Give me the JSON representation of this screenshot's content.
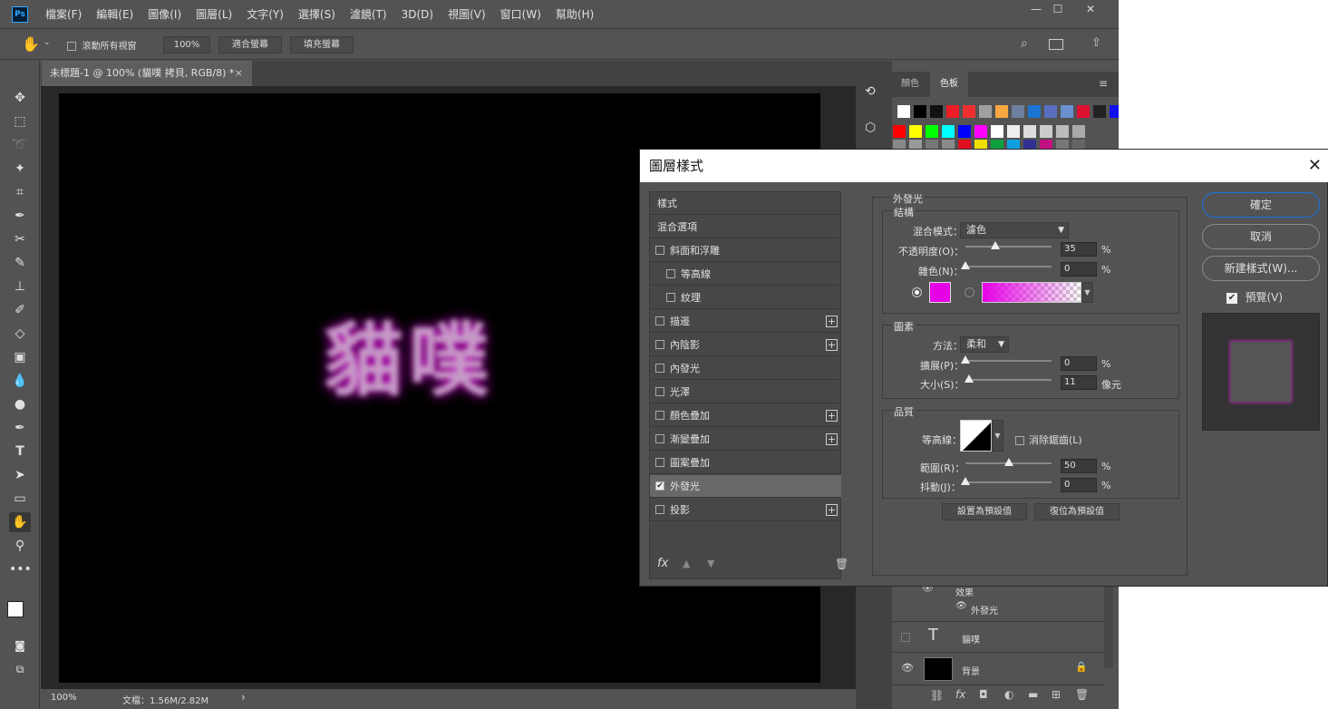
{
  "app": {
    "logo": "Ps"
  },
  "menu": [
    "檔案(F)",
    "編輯(E)",
    "圖像(I)",
    "圖層(L)",
    "文字(Y)",
    "選擇(S)",
    "濾鏡(T)",
    "3D(D)",
    "視圖(V)",
    "窗口(W)",
    "幫助(H)"
  ],
  "window_controls": {
    "minimize": "—",
    "restore": "☐",
    "close": "✕"
  },
  "options": {
    "scroll_all": "滾動所有視窗",
    "zoom": "100%",
    "fit_screen": "適合螢幕",
    "fill_screen": "填充螢幕"
  },
  "document": {
    "tab_title": "未標題-1 @ 100% (貓噗 拷貝, RGB/8) *",
    "tab_close": "×",
    "canvas_text": "貓噗"
  },
  "status": {
    "zoom": "100%",
    "doc_info": "文檔：1.56M/2.82M",
    "arrow": "›"
  },
  "panels": {
    "tab_color": "顏色",
    "tab_swatches": "色板"
  },
  "swatches_row1": [
    "#ffffff",
    "#000000",
    "#111111",
    "#ee1c24",
    "#f03030",
    "#a0a0a0",
    "#f7a840",
    "#6f7f9f",
    "#1a75d2",
    "#5a6fbf",
    "#6a90d0",
    "#e01030",
    "#222222",
    "#1010ee"
  ],
  "swatches_row2": [
    "#ff0000",
    "#ffff00",
    "#00ff00",
    "#00ffff",
    "#0000ff",
    "#ff00ff",
    "#ffffff",
    "#eeeeee",
    "#dddddd",
    "#cccccc",
    "#bbbbbb",
    "#aaaaaa"
  ],
  "swatches_row3": [
    "#888888",
    "#999999",
    "#777777",
    "#8a8a8a",
    "#e01020",
    "#f0e000",
    "#10a040",
    "#10a0e0",
    "#303090",
    "#c01080",
    "#777777",
    "#666666"
  ],
  "layers": {
    "effects_label": "效果",
    "effect_outer_glow": "外發光",
    "text_layer": "貓噗",
    "bg_layer": "背景",
    "text_icon": "T"
  },
  "dialog": {
    "title": "圖層樣式",
    "close": "✕",
    "styles_header": "樣式",
    "blend_options": "混合選項",
    "items": [
      {
        "label": "斜面和浮雕",
        "checked": false,
        "plus": false,
        "indent": false
      },
      {
        "label": "等高線",
        "checked": false,
        "plus": false,
        "indent": true
      },
      {
        "label": "紋理",
        "checked": false,
        "plus": false,
        "indent": true
      },
      {
        "label": "描邊",
        "checked": false,
        "plus": true,
        "indent": false
      },
      {
        "label": "內陰影",
        "checked": false,
        "plus": true,
        "indent": false
      },
      {
        "label": "內發光",
        "checked": false,
        "plus": false,
        "indent": false
      },
      {
        "label": "光澤",
        "checked": false,
        "plus": false,
        "indent": false
      },
      {
        "label": "顏色疊加",
        "checked": false,
        "plus": true,
        "indent": false
      },
      {
        "label": "漸變疊加",
        "checked": false,
        "plus": true,
        "indent": false
      },
      {
        "label": "圖案疊加",
        "checked": false,
        "plus": false,
        "indent": false
      },
      {
        "label": "外發光",
        "checked": true,
        "plus": false,
        "indent": false
      },
      {
        "label": "投影",
        "checked": false,
        "plus": true,
        "indent": false
      }
    ],
    "fx_label": "fx",
    "section_title": "外發光",
    "structure": {
      "title": "結構",
      "blend_mode_label": "混合模式：",
      "blend_mode": "濾色",
      "opacity_label": "不透明度(O)：",
      "opacity": "35",
      "noise_label": "雜色(N)：",
      "noise": "0",
      "pct": "%",
      "glow_color": "#e600e6"
    },
    "elements": {
      "title": "圖素",
      "method_label": "方法：",
      "method": "柔和",
      "spread_label": "擴展(P)：",
      "spread": "0",
      "size_label": "大小(S)：",
      "size": "11",
      "size_unit": "像元",
      "pct": "%"
    },
    "quality": {
      "title": "品質",
      "contour_label": "等高線：",
      "anti_alias": "消除鋸齒(L)",
      "range_label": "範圍(R)：",
      "range": "50",
      "jitter_label": "抖動(J)：",
      "jitter": "0",
      "pct": "%"
    },
    "make_default": "設置為預設值",
    "reset_default": "復位為預設值",
    "ok": "確定",
    "cancel": "取消",
    "new_style": "新建樣式(W)...",
    "preview": "預覽(V)",
    "slider_levels": {
      "opacity": 0.35,
      "noise": 0,
      "spread": 0,
      "size": 0.045,
      "range": 0.5,
      "jitter": 0
    }
  }
}
